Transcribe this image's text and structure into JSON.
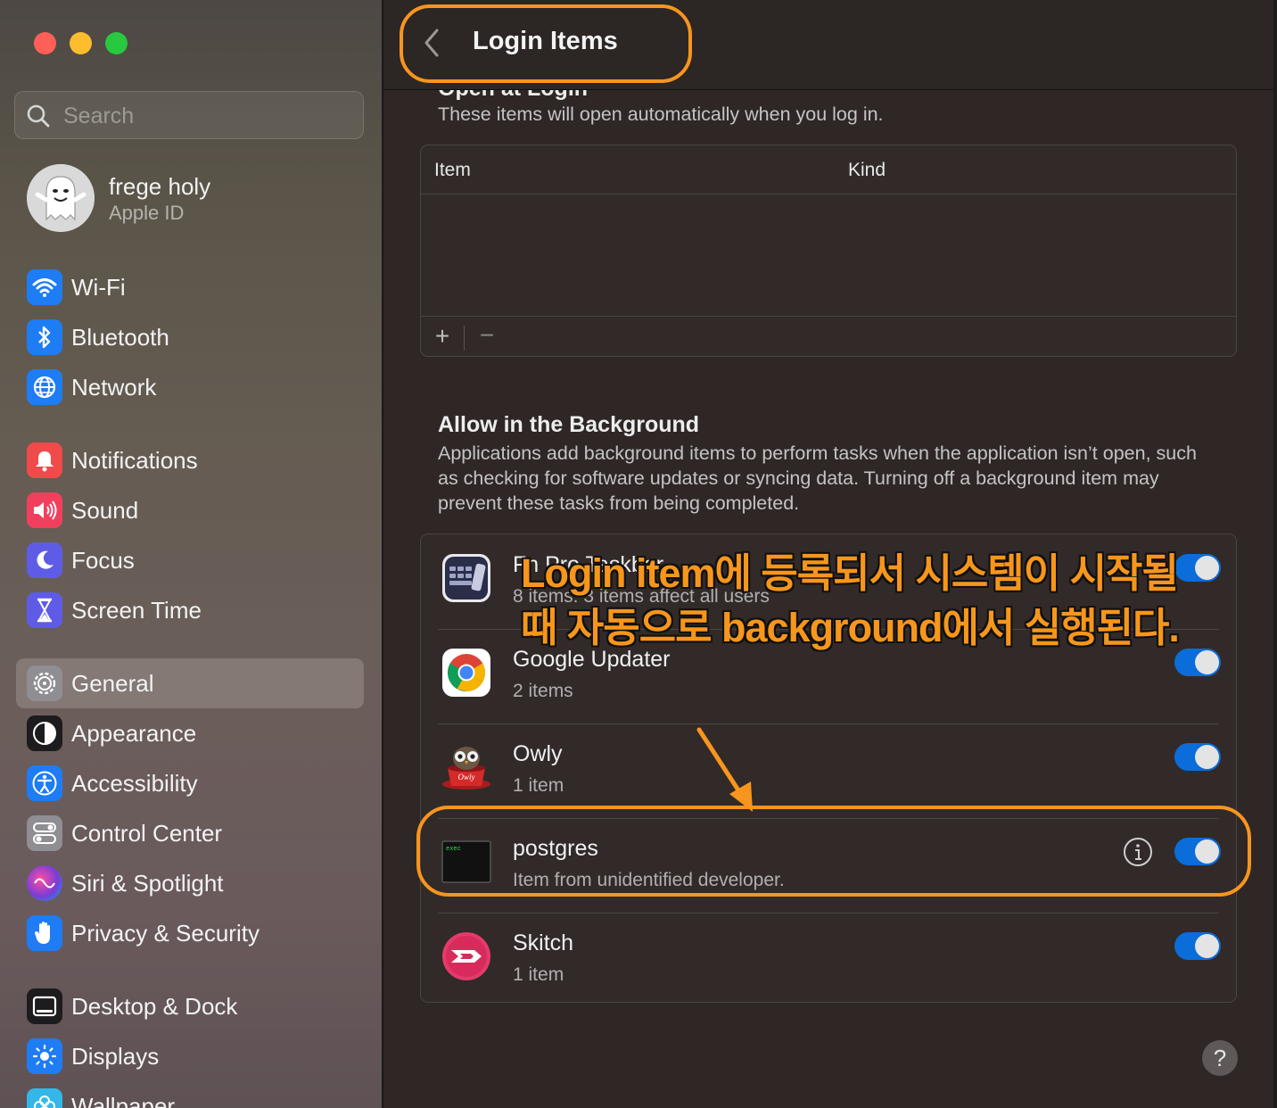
{
  "sidebar": {
    "search_placeholder": "Search",
    "user": {
      "name": "frege holy",
      "subtitle": "Apple ID",
      "icon": "ghost-avatar"
    },
    "items": [
      {
        "label": "Wi-Fi",
        "icon": "wifi-icon",
        "color": "#1e7cf5"
      },
      {
        "label": "Bluetooth",
        "icon": "bluetooth-icon",
        "color": "#1e7cf5"
      },
      {
        "label": "Network",
        "icon": "globe-icon",
        "color": "#1e7cf5"
      },
      {
        "label": "Notifications",
        "icon": "bell-icon",
        "color": "#f04a4a"
      },
      {
        "label": "Sound",
        "icon": "speaker-icon",
        "color": "#f0405d"
      },
      {
        "label": "Focus",
        "icon": "moon-icon",
        "color": "#5e5ce6"
      },
      {
        "label": "Screen Time",
        "icon": "hourglass-icon",
        "color": "#5e5ce6"
      },
      {
        "label": "General",
        "icon": "gear-icon",
        "color": "#8e8e93",
        "selected": true
      },
      {
        "label": "Appearance",
        "icon": "appearance-icon",
        "color": "#1c1c1e"
      },
      {
        "label": "Accessibility",
        "icon": "accessibility-icon",
        "color": "#1e7cf5"
      },
      {
        "label": "Control Center",
        "icon": "toggles-icon",
        "color": "#8e8e93"
      },
      {
        "label": "Siri & Spotlight",
        "icon": "siri-icon",
        "color": "#7a3cd6"
      },
      {
        "label": "Privacy & Security",
        "icon": "hand-icon",
        "color": "#1e7cf5"
      },
      {
        "label": "Desktop & Dock",
        "icon": "dock-icon",
        "color": "#1c1c1e"
      },
      {
        "label": "Displays",
        "icon": "sun-icon",
        "color": "#1e7cf5"
      },
      {
        "label": "Wallpaper",
        "icon": "flower-icon",
        "color": "#34b7e8"
      }
    ]
  },
  "header": {
    "title": "Login Items"
  },
  "open_at_login": {
    "title": "Open at Login",
    "description": "These items will open automatically when you log in.",
    "columns": {
      "item": "Item",
      "kind": "Kind"
    },
    "add_label": "+",
    "remove_label": "−"
  },
  "background": {
    "title": "Allow in the Background",
    "description": "Applications add background items to perform tasks when the application isn’t open, such as checking for software updates or syncing data. Turning off a background item may prevent these tasks from being completed.",
    "items": [
      {
        "name": "Fn Pro Taskbar",
        "detail": "8 items: 3 items affect all users",
        "icon": "keyboard-app-icon",
        "enabled": true
      },
      {
        "name": "Google Updater",
        "detail": "2 items",
        "icon": "chrome-icon",
        "enabled": true
      },
      {
        "name": "Owly",
        "detail": "1 item",
        "icon": "owly-icon",
        "enabled": true
      },
      {
        "name": "postgres",
        "detail": "Item from unidentified developer.",
        "icon": "exec-terminal-icon",
        "enabled": true,
        "info_button": true
      },
      {
        "name": "Skitch",
        "detail": "1 item",
        "icon": "skitch-icon",
        "enabled": true
      }
    ]
  },
  "help_label": "?",
  "annotation": {
    "text": "Login item에 등록되서 시스템이 시작될때 자동으로 background에서 실행된다.",
    "color": "#f7951e"
  }
}
